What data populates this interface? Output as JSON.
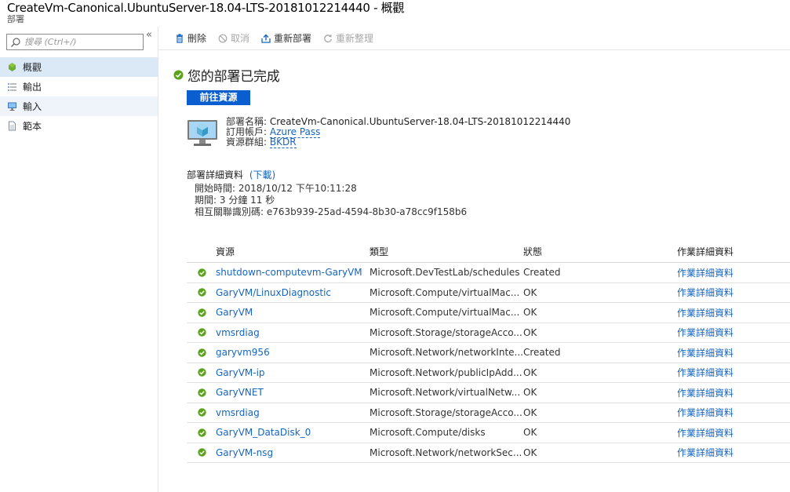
{
  "header": {
    "title": "CreateVm-Canonical.UbuntuServer-18.04-LTS-20181012214440 - 概觀",
    "subtitle": "部署"
  },
  "sidebar": {
    "search_placeholder": "搜尋 (Ctrl+/)",
    "collapse_glyph": "«",
    "items": [
      {
        "label": "概觀",
        "icon": "overview-icon"
      },
      {
        "label": "輸出",
        "icon": "list-icon"
      },
      {
        "label": "輸入",
        "icon": "monitor-icon"
      },
      {
        "label": "範本",
        "icon": "document-icon"
      }
    ]
  },
  "toolbar": {
    "delete": "刪除",
    "cancel": "取消",
    "redeploy": "重新部署",
    "refresh": "重新整理"
  },
  "main": {
    "status_title": "您的部署已完成",
    "goto_button": "前往資源",
    "summary": {
      "deployment_name_label": "部署名稱:",
      "deployment_name": "CreateVm-Canonical.UbuntuServer-18.04-LTS-20181012214440",
      "subscription_label": "訂用帳戶:",
      "subscription": "Azure Pass",
      "resource_group_label": "資源群組:",
      "resource_group": "BKDR"
    },
    "details": {
      "heading": "部署詳細資料",
      "download": "(下載)",
      "start_time_label": "開始時間:",
      "start_time": "2018/10/12 下午10:11:28",
      "duration_label": "期間:",
      "duration": "3 分鐘 11 秒",
      "correlation_label": "相互關聯識別碼:",
      "correlation_id": "e763b939-25ad-4594-8b30-a78cc9f158b6"
    },
    "table": {
      "headers": [
        "資源",
        "類型",
        "狀態",
        "作業詳細資料"
      ],
      "rows": [
        {
          "resource": "shutdown-computevm-GaryVM",
          "type": "Microsoft.DevTestLab/schedules",
          "state": "Created",
          "op": "作業詳細資料"
        },
        {
          "resource": "GaryVM/LinuxDiagnostic",
          "type": "Microsoft.Compute/virtualMac...",
          "state": "OK",
          "op": "作業詳細資料"
        },
        {
          "resource": "GaryVM",
          "type": "Microsoft.Compute/virtualMac...",
          "state": "OK",
          "op": "作業詳細資料"
        },
        {
          "resource": "vmsrdiag",
          "type": "Microsoft.Storage/storageAcco...",
          "state": "OK",
          "op": "作業詳細資料"
        },
        {
          "resource": "garyvm956",
          "type": "Microsoft.Network/networkInte...",
          "state": "Created",
          "op": "作業詳細資料"
        },
        {
          "resource": "GaryVM-ip",
          "type": "Microsoft.Network/publicIpAdd...",
          "state": "OK",
          "op": "作業詳細資料"
        },
        {
          "resource": "GaryVNET",
          "type": "Microsoft.Network/virtualNetw...",
          "state": "OK",
          "op": "作業詳細資料"
        },
        {
          "resource": "vmsrdiag",
          "type": "Microsoft.Storage/storageAcco...",
          "state": "OK",
          "op": "作業詳細資料"
        },
        {
          "resource": "GaryVM_DataDisk_0",
          "type": "Microsoft.Compute/disks",
          "state": "OK",
          "op": "作業詳細資料"
        },
        {
          "resource": "GaryVM-nsg",
          "type": "Microsoft.Network/networkSec...",
          "state": "OK",
          "op": "作業詳細資料"
        }
      ]
    }
  },
  "colors": {
    "accent": "#0a5ecf",
    "link": "#1665c0",
    "success": "#5aa31a",
    "nav_active": "#dbe9f7"
  }
}
